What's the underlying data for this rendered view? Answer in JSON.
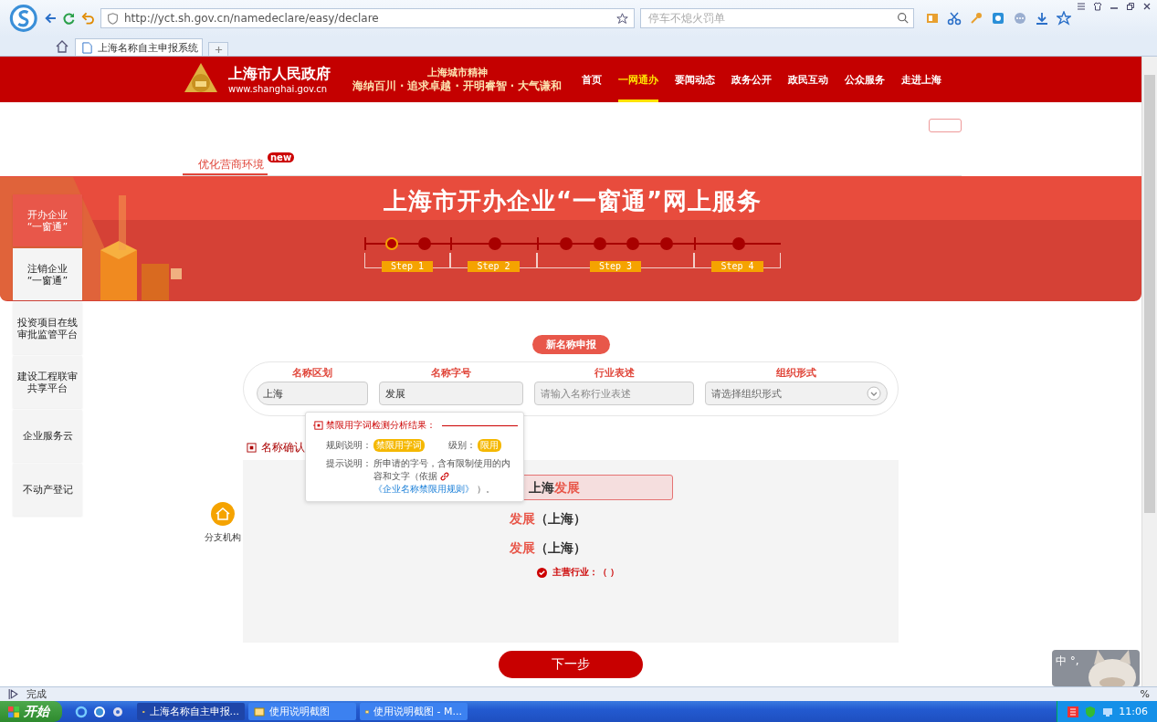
{
  "browser": {
    "address": "http://yct.sh.gov.cn/namedeclare/easy/declare",
    "search_placeholder": "停车不熄火罚单",
    "tabs": [
      {
        "label": "上海名称自主申报系统",
        "selected": true
      }
    ],
    "status_text": "完成",
    "zoom_text": "%"
  },
  "header": {
    "site_name": "上海市人民政府",
    "site_url": "www.shanghai.gov.cn",
    "slogan_title": "上海城市精神",
    "slogan": "海纳百川 · 追求卓越 · 开明睿智 · 大气谦和",
    "nav": [
      {
        "label": "首页",
        "selected": false
      },
      {
        "label": "一网通办",
        "selected": true
      },
      {
        "label": "要闻动态",
        "selected": false
      },
      {
        "label": "政务公开",
        "selected": false
      },
      {
        "label": "政民互动",
        "selected": false
      },
      {
        "label": "公众服务",
        "selected": false
      },
      {
        "label": "走进上海",
        "selected": false
      }
    ]
  },
  "subnav": {
    "label": "优化营商环境",
    "badge": "new"
  },
  "banner": {
    "title": "上海市开办企业“一窗通”网上服务",
    "steps": [
      {
        "label": "Step 1",
        "nodes": [
          {
            "selected": true
          },
          {
            "selected": false
          }
        ]
      },
      {
        "label": "Step 2",
        "nodes": [
          {
            "selected": false
          }
        ]
      },
      {
        "label": "Step 3",
        "nodes": [
          {
            "selected": false
          },
          {
            "selected": false
          },
          {
            "selected": false
          },
          {
            "selected": false
          }
        ]
      },
      {
        "label": "Step 4",
        "nodes": [
          {
            "selected": false
          }
        ]
      }
    ]
  },
  "sidebar": [
    {
      "label": "开办企业\n“一窗通”",
      "selected": true
    },
    {
      "label": "注销企业\n“一窗通”",
      "selected": false
    },
    {
      "label": "投资项目在线审批监管平台",
      "selected": false
    },
    {
      "label": "建设工程联审共享平台",
      "selected": false
    },
    {
      "label": "企业服务云",
      "selected": false
    },
    {
      "label": "不动产登记",
      "selected": false
    }
  ],
  "form": {
    "title": "新名称申报",
    "fields": [
      {
        "label": "名称区划",
        "kind": "text",
        "value": "上海"
      },
      {
        "label": "名称字号",
        "kind": "text",
        "value": "发展"
      },
      {
        "label": "行业表述",
        "kind": "text",
        "placeholder": "请输入名称行业表述"
      },
      {
        "label": "组织形式",
        "kind": "select",
        "placeholder": "请选择组织形式"
      }
    ]
  },
  "popup": {
    "title": "禁限用字词检测分析结果：",
    "rule_label": "规则说明：",
    "rule_value": "禁限用字词",
    "level_label": "级别：",
    "level_value": "限用",
    "hint_label": "提示说明：",
    "hint_text": "所申请的字号，含有限制使用的内容和文字（依据",
    "hint_link": "《企业名称禁限用规则》",
    "hint_end": "）。"
  },
  "confirm": {
    "label": "名称确认",
    "names": [
      {
        "prefix": "上海",
        "keyword": "发展",
        "selected": true
      },
      {
        "keyword": "发展",
        "suffix": "（上海）",
        "selected": false
      },
      {
        "keyword": "发展",
        "suffix": "（上海）",
        "selected": false
      }
    ],
    "industry": "主营行业：（ ）"
  },
  "branch": {
    "label": "分支机构"
  },
  "next_button": "下一步",
  "ime": {
    "label": "中 °,"
  },
  "taskbar": {
    "start": "开始",
    "tasks": [
      {
        "label": "上海名称自主申报...",
        "selected": true
      },
      {
        "label": "使用说明截图",
        "selected": false
      },
      {
        "label": "使用说明截图 - M...",
        "selected": false
      }
    ],
    "clock": "11:06"
  }
}
